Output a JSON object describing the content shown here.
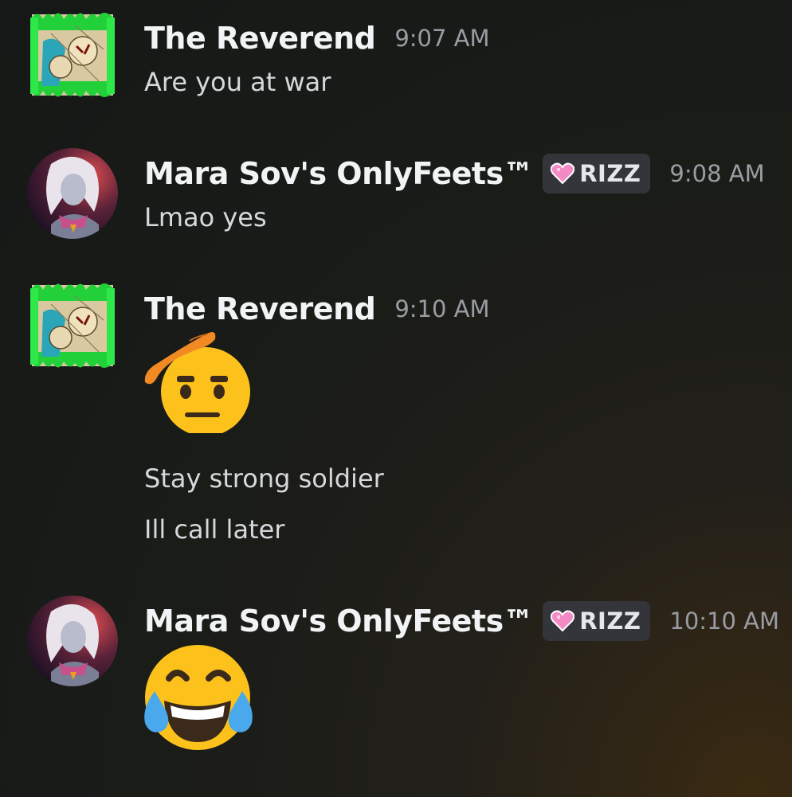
{
  "messages": [
    {
      "author": "The Reverend",
      "time": "9:07 AM",
      "avatar": "reverend-avatar",
      "lines": [
        "Are you at war"
      ]
    },
    {
      "author": "Mara Sov's OnlyFeets™",
      "tag": {
        "icon": "pink-heart-icon",
        "label": "RIZZ"
      },
      "time": "9:08 AM",
      "avatar": "mara-avatar",
      "lines": [
        "Lmao yes"
      ]
    },
    {
      "author": "The Reverend",
      "time": "9:10 AM",
      "avatar": "reverend-avatar",
      "emoji": "saluting-face",
      "lines": [
        "Stay strong soldier",
        "Ill call later"
      ]
    },
    {
      "author": "Mara Sov's OnlyFeets™",
      "tag": {
        "icon": "pink-heart-icon",
        "label": "RIZZ"
      },
      "time": "10:10 AM",
      "avatar": "mara-avatar",
      "emoji": "face-with-tears-of-joy",
      "lines": []
    }
  ],
  "colors": {
    "background": "#181a17",
    "username": "#f2f3f5",
    "timestamp": "#9a9ca3",
    "message_text": "#d6d8dc",
    "tag_bg": "#33353a"
  }
}
